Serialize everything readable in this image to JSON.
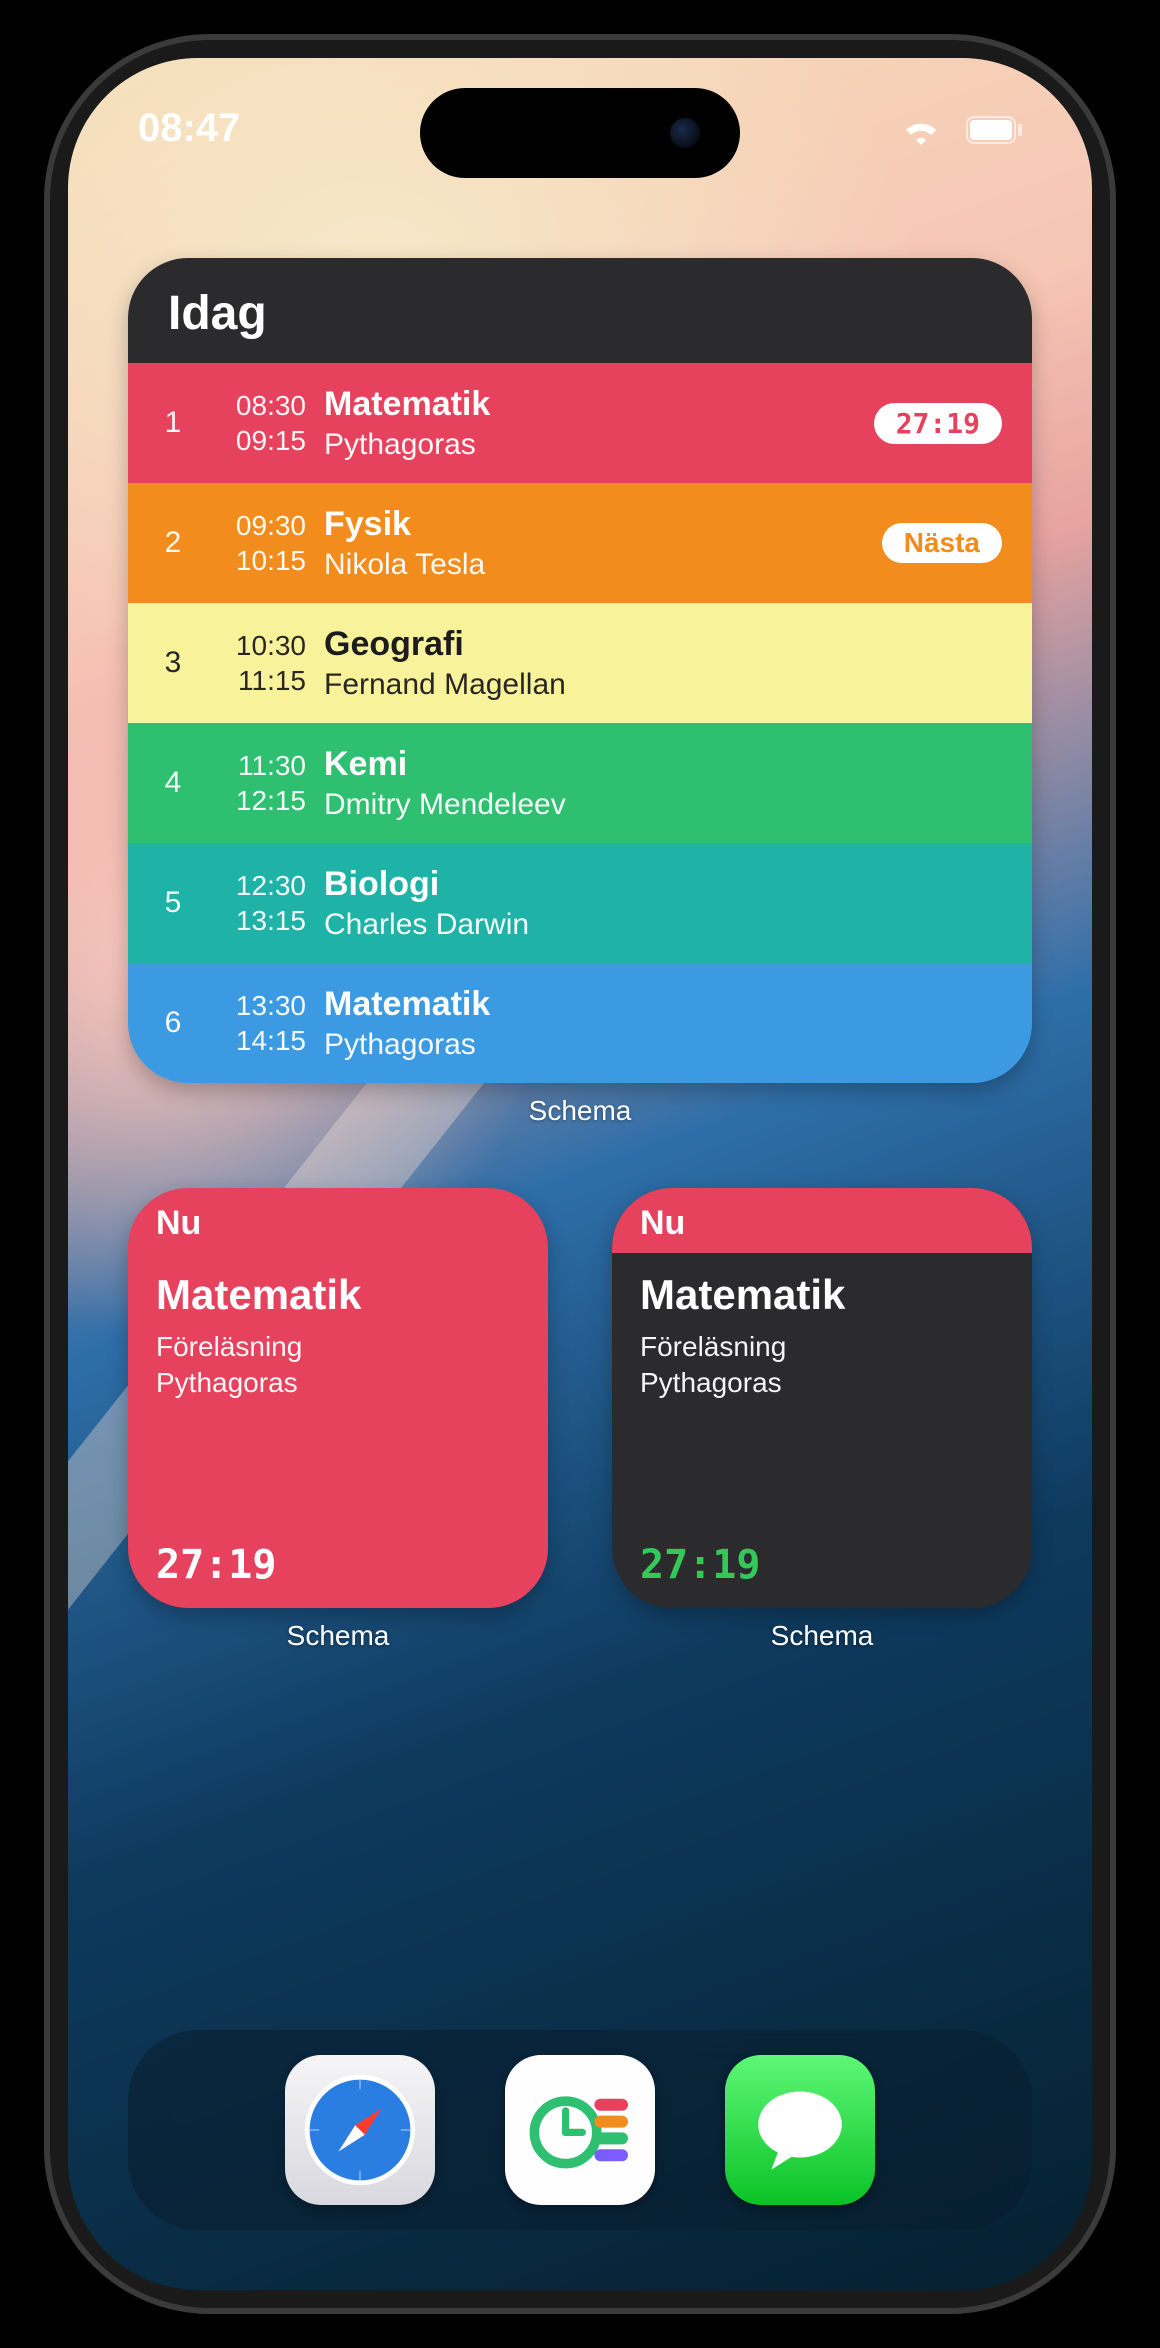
{
  "statusbar": {
    "time": "08:47"
  },
  "widget_large": {
    "title": "Idag",
    "label": "Schema",
    "lessons": [
      {
        "num": "1",
        "start": "08:30",
        "end": "09:15",
        "subject": "Matematik",
        "teacher": "Pythagoras",
        "badge": "27:19",
        "badge_type": "timer",
        "color": "#e6425e",
        "text": "light"
      },
      {
        "num": "2",
        "start": "09:30",
        "end": "10:15",
        "subject": "Fysik",
        "teacher": "Nikola Tesla",
        "badge": "Nästa",
        "badge_type": "text",
        "color": "#f28c1c",
        "text": "light"
      },
      {
        "num": "3",
        "start": "10:30",
        "end": "11:15",
        "subject": "Geografi",
        "teacher": "Fernand Magellan",
        "badge": "",
        "badge_type": "",
        "color": "#f8f29a",
        "text": "dark"
      },
      {
        "num": "4",
        "start": "11:30",
        "end": "12:15",
        "subject": "Kemi",
        "teacher": "Dmitry Mendeleev",
        "badge": "",
        "badge_type": "",
        "color": "#2fbf71",
        "text": "light"
      },
      {
        "num": "5",
        "start": "12:30",
        "end": "13:15",
        "subject": "Biologi",
        "teacher": "Charles Darwin",
        "badge": "",
        "badge_type": "",
        "color": "#1fb2a6",
        "text": "light"
      },
      {
        "num": "6",
        "start": "13:30",
        "end": "14:15",
        "subject": "Matematik",
        "teacher": "Pythagoras",
        "badge": "",
        "badge_type": "",
        "color": "#3b9ae1",
        "text": "light"
      }
    ]
  },
  "widget_small_1": {
    "header": "Nu",
    "title": "Matematik",
    "line1": "Föreläsning",
    "line2": "Pythagoras",
    "timer": "27:19",
    "label": "Schema"
  },
  "widget_small_2": {
    "header": "Nu",
    "title": "Matematik",
    "line1": "Föreläsning",
    "line2": "Pythagoras",
    "timer": "27:19",
    "label": "Schema"
  },
  "dock": {
    "apps": [
      "safari",
      "schedule",
      "messages"
    ]
  }
}
